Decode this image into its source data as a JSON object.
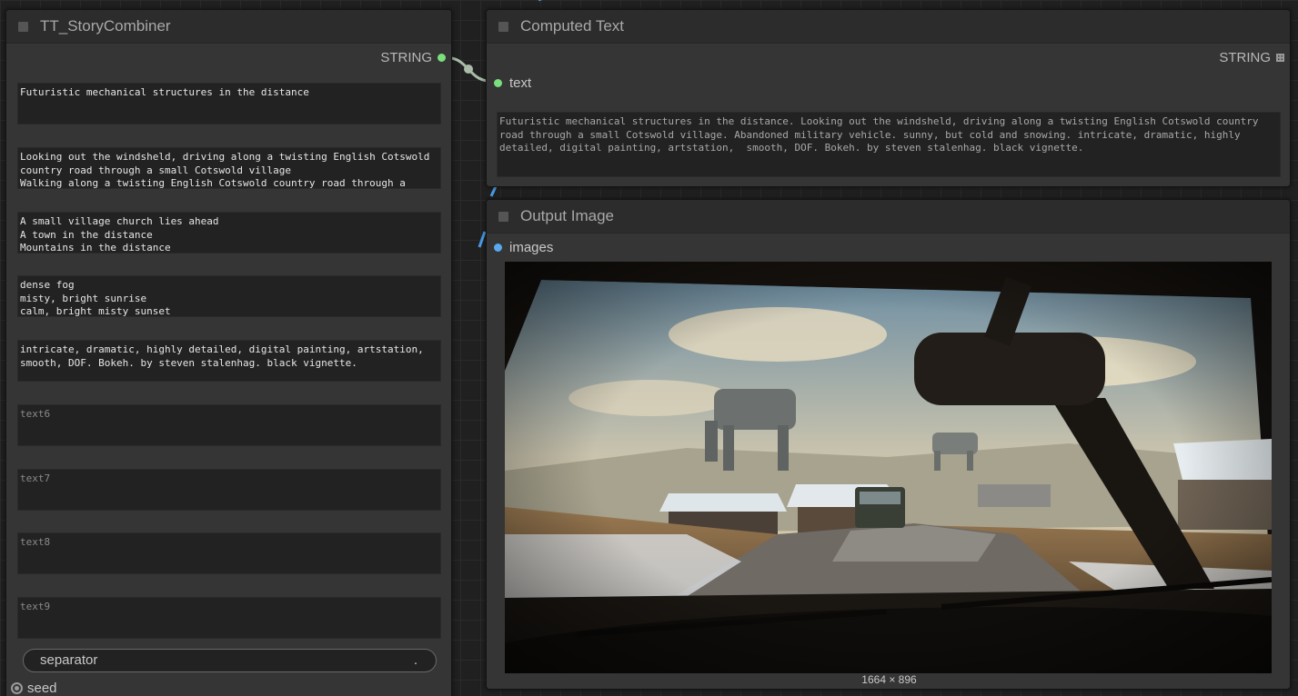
{
  "colors": {
    "string_socket": "#7be07b",
    "image_socket": "#5aa8ee",
    "link_string": "#a8bca8",
    "link_image": "#4a9ce8"
  },
  "combiner": {
    "title": "TT_StoryCombiner",
    "output_label": "STRING",
    "texts": [
      {
        "value": "Futuristic mechanical structures in the distance",
        "placeholder": ""
      },
      {
        "value": "Looking out the windsheld, driving along a twisting English Cotswold\ncountry road through a small Cotswold village\nWalking along a twisting English Cotswold country road through a",
        "placeholder": ""
      },
      {
        "value": "A small village church lies ahead\nA town in the distance\nMountains in the distance",
        "placeholder": ""
      },
      {
        "value": "dense fog\nmisty, bright sunrise\ncalm, bright misty sunset",
        "placeholder": ""
      },
      {
        "value": "intricate, dramatic, highly detailed, digital painting, artstation,\nsmooth, DOF. Bokeh. by steven stalenhag. black vignette.",
        "placeholder": ""
      },
      {
        "value": "",
        "placeholder": "text6"
      },
      {
        "value": "",
        "placeholder": "text7"
      },
      {
        "value": "",
        "placeholder": "text8"
      },
      {
        "value": "",
        "placeholder": "text9"
      }
    ],
    "separator_label": "separator",
    "separator_value": ".",
    "seed_label": "seed"
  },
  "computed": {
    "title": "Computed Text",
    "input_label": "text",
    "output_label": "STRING",
    "output_icon": "grid-icon",
    "text": "Futuristic mechanical structures in the distance. Looking out the windsheld, driving along a twisting English Cotswold country\nroad through a small Cotswold village. Abandoned military vehicle. sunny, but cold and snowing. intricate, dramatic, highly\ndetailed, digital painting, artstation,  smooth, DOF. Bokeh. by steven stalenhag. black vignette."
  },
  "output": {
    "title": "Output Image",
    "input_label": "images",
    "image_size": "1664 × 896"
  }
}
